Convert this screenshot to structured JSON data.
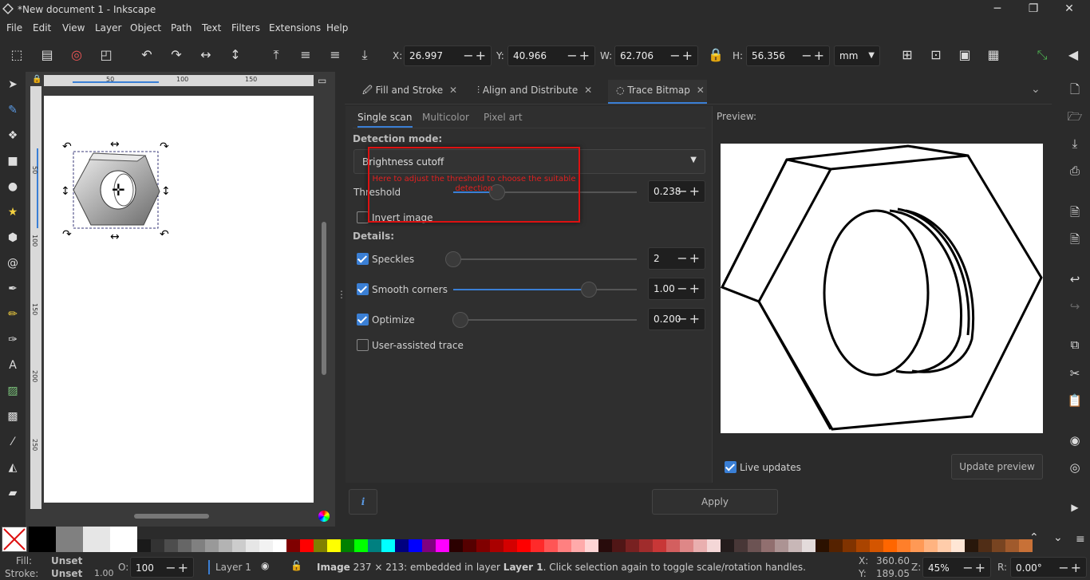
{
  "window": {
    "title": "*New document 1 - Inkscape",
    "minimize": "─",
    "restore": "❐",
    "close": "✕"
  },
  "menu": [
    "File",
    "Edit",
    "View",
    "Layer",
    "Object",
    "Path",
    "Text",
    "Filters",
    "Extensions",
    "Help"
  ],
  "toolbar": {
    "x_label": "X:",
    "x_value": "26.997",
    "y_label": "Y:",
    "y_value": "40.966",
    "w_label": "W:",
    "w_value": "62.706",
    "h_label": "H:",
    "h_value": "56.356",
    "unit": "mm"
  },
  "ruler": {
    "top_ticks": [
      "50",
      "100",
      "150"
    ],
    "left_ticks": [
      "50",
      "100",
      "150",
      "200",
      "250"
    ]
  },
  "dock": {
    "tabs": [
      {
        "label": "Fill and Stroke",
        "close": "✕"
      },
      {
        "label": "Align and Distribute",
        "close": "✕"
      },
      {
        "label": "Trace Bitmap",
        "close": "✕"
      }
    ],
    "subtabs": [
      "Single scan",
      "Multicolor",
      "Pixel art"
    ],
    "detection_mode_label": "Detection mode:",
    "detection_mode_value": "Brightness cutoff",
    "threshold_label": "Threshold",
    "threshold_value": "0.238",
    "threshold_level": 0.238,
    "invert_label": "Invert image",
    "details_label": "Details:",
    "speckles_label": "Speckles",
    "speckles_value": "2",
    "smooth_label": "Smooth corners",
    "smooth_value": "1.00",
    "smooth_level": 0.74,
    "optimize_label": "Optimize",
    "optimize_value": "0.200",
    "user_assisted_label": "User-assisted trace",
    "preview_label": "Preview:",
    "live_updates_label": "Live updates",
    "update_preview_label": "Update preview",
    "apply_label": "Apply",
    "info_icon": "i",
    "annotation_text": "Here to adjust the threshold to choose the suitable detection"
  },
  "status": {
    "fill_label": "Fill:",
    "fill_value": "Unset",
    "stroke_label": "Stroke:",
    "stroke_value": "Unset",
    "stroke_width": "1.00",
    "opacity_label": "O:",
    "opacity_value": "100",
    "layer": "Layer 1",
    "message_prefix": "Image",
    "message_body": "237 × 213: embedded in layer",
    "message_layer": "Layer 1",
    "message_tail": ". Click selection again to toggle scale/rotation handles.",
    "x_label": "X:",
    "x_value": "360.60",
    "y_label": "Y:",
    "y_value": "189.05",
    "zoom_label": "Z:",
    "zoom_value": "45%",
    "rot_label": "R:",
    "rot_value": "0.00°"
  },
  "palette_colors": [
    "#000000",
    "#808080",
    "#e6e6e6",
    "#ffffff",
    "#1a1a1a",
    "#333333",
    "#4d4d4d",
    "#666666",
    "#808080",
    "#999999",
    "#b3b3b3",
    "#cccccc",
    "#e6e6e6",
    "#f2f2f2",
    "#ffffff",
    "#800000",
    "#ff0000",
    "#808000",
    "#ffff00",
    "#008000",
    "#00ff00",
    "#008080",
    "#00ffff",
    "#000080",
    "#0000ff",
    "#800080",
    "#ff00ff",
    "#2b0000",
    "#550000",
    "#800000",
    "#aa0000",
    "#d40000",
    "#ff0000",
    "#ff2a2a",
    "#ff5555",
    "#ff8080",
    "#ffaaaa",
    "#ffd5d5",
    "#280b0b",
    "#501616",
    "#782121",
    "#a02c2c",
    "#c83737",
    "#d35f5f",
    "#de8787",
    "#e9afaf",
    "#f4d7d7",
    "#241c1c",
    "#483737",
    "#6c5353",
    "#916f6f",
    "#ac9393",
    "#c8b7b7",
    "#e3dbdb",
    "#2b1100",
    "#552200",
    "#803300",
    "#aa4400",
    "#d45500",
    "#ff6600",
    "#ff7f2a",
    "#ff9955",
    "#ffb380",
    "#ffccaa",
    "#ffe6d5",
    "#28170b",
    "#502d16",
    "#784421",
    "#a05a2c",
    "#c87137"
  ]
}
